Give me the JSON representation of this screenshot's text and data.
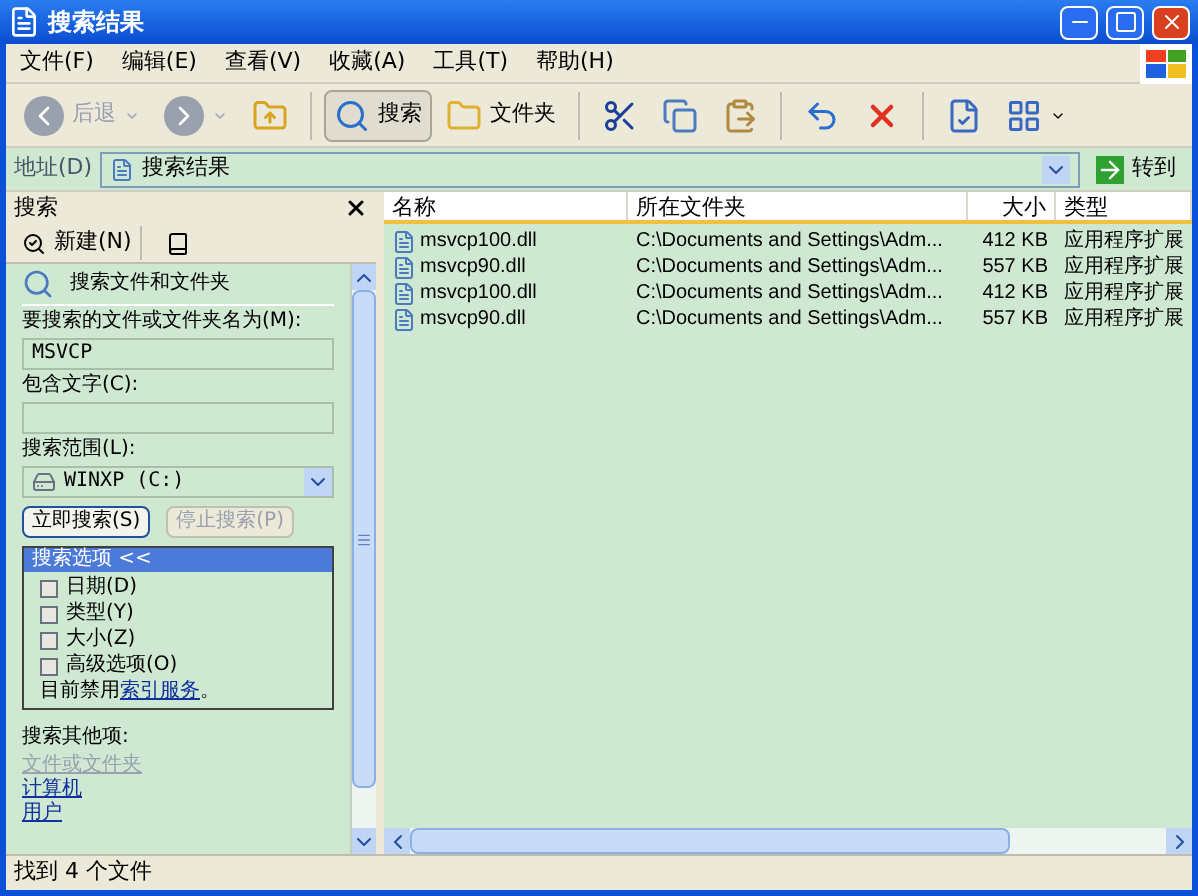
{
  "window": {
    "title": "搜索结果"
  },
  "menu": [
    "文件(F)",
    "编辑(E)",
    "查看(V)",
    "收藏(A)",
    "工具(T)",
    "帮助(H)"
  ],
  "toolbar": [
    {
      "kind": "back",
      "label": "后退",
      "disabled": true
    },
    {
      "kind": "forward",
      "disabled": true
    },
    {
      "kind": "up"
    },
    {
      "kind": "search",
      "label": "搜索",
      "selected": true
    },
    {
      "kind": "folders",
      "label": "文件夹",
      "selected": false
    },
    {
      "kind": "cut"
    },
    {
      "kind": "copy"
    },
    {
      "kind": "paste"
    },
    {
      "kind": "undo"
    },
    {
      "kind": "delete"
    },
    {
      "kind": "properties"
    },
    {
      "kind": "views"
    }
  ],
  "address": {
    "label": "地址(D)",
    "value": "搜索结果",
    "go": "转到"
  },
  "search_pane": {
    "title": "搜索",
    "new_button": "新建(N)",
    "heading": "搜索文件和文件夹",
    "name_label": "要搜索的文件或文件夹名为(M):",
    "name_value": "MSVCP",
    "contains_label": "包含文字(C):",
    "scope_label": "搜索范围(L):",
    "scope_value": "WINXP (C:)",
    "buttons": [
      {
        "label": "立即搜索(S)",
        "disabled": false
      },
      {
        "label": "停止搜索(P)",
        "disabled": true
      }
    ],
    "options_header": "搜索选项 <<",
    "options": [
      {
        "label": "日期(D)",
        "checked": false
      },
      {
        "label": "类型(Y)",
        "checked": false
      },
      {
        "label": "大小(Z)",
        "checked": false
      },
      {
        "label": "高级选项(O)",
        "checked": false
      }
    ],
    "note_prefix": "目前禁用",
    "note_link": "索引服务",
    "note_suffix": "。",
    "other_label": "搜索其他项:",
    "other_links": [
      {
        "label": "文件或文件夹",
        "disabled": true
      },
      {
        "label": "计算机",
        "disabled": false
      },
      {
        "label": "用户",
        "disabled": false
      }
    ]
  },
  "table": {
    "columns": [
      "名称",
      "所在文件夹",
      "大小",
      "类型"
    ],
    "rows": [
      [
        "msvcp100.dll",
        "C:\\Documents and Settings\\Adm...",
        "412 KB",
        "应用程序扩展"
      ],
      [
        "msvcp90.dll",
        "C:\\Documents and Settings\\Adm...",
        "557 KB",
        "应用程序扩展"
      ],
      [
        "msvcp100.dll",
        "C:\\Documents and Settings\\Adm...",
        "412 KB",
        "应用程序扩展"
      ],
      [
        "msvcp90.dll",
        "C:\\Documents and Settings\\Adm...",
        "557 KB",
        "应用程序扩展"
      ]
    ]
  },
  "status_bar": "找到 4 个文件"
}
